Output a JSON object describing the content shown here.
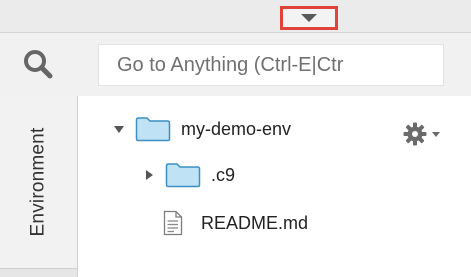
{
  "search": {
    "placeholder": "Go to Anything (Ctrl-E|Ctr"
  },
  "sidebar": {
    "environment_tab_label": "Environment"
  },
  "file_tree": {
    "root": {
      "label": "my-demo-env",
      "expanded": true,
      "icon": "folder-icon"
    },
    "children": [
      {
        "label": ".c9",
        "type": "folder",
        "expanded": false,
        "icon": "folder-icon"
      },
      {
        "label": "README.md",
        "type": "file",
        "icon": "file-icon"
      }
    ]
  },
  "colors": {
    "highlight_border": "#e0433a",
    "folder_fill": "#bfe3f5",
    "folder_stroke": "#3b8fc4",
    "panel_bg": "#f1f1f1"
  },
  "icons": {
    "collapse": "chevron-down-icon",
    "search": "search-icon",
    "settings": "gear-icon"
  }
}
